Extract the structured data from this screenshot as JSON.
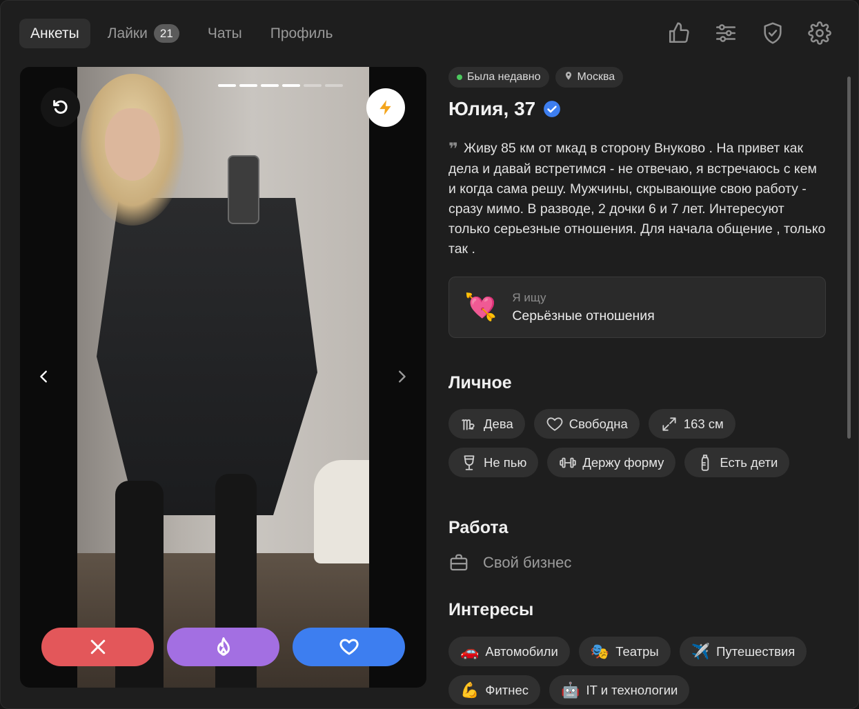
{
  "nav": {
    "tabs": [
      {
        "label": "Анкеты",
        "active": true
      },
      {
        "label": "Лайки",
        "badge": "21"
      },
      {
        "label": "Чаты"
      },
      {
        "label": "Профиль"
      }
    ],
    "icons": [
      "thumbs-up-icon",
      "sliders-icon",
      "shield-check-icon",
      "gear-icon"
    ]
  },
  "photo": {
    "count": 6,
    "current": 4,
    "undo_icon": "undo-icon",
    "boost_icon": "lightning-icon",
    "actions": [
      "close-icon",
      "flame-icon",
      "heart-icon"
    ]
  },
  "profile": {
    "status": "Была недавно",
    "city": "Москва",
    "name": "Юлия, 37",
    "verified": true,
    "bio": "Живу 85 км от мкад в сторону Внуково . На привет как дела и давай встретимся - не отвечаю, я встречаюсь с кем и когда сама решу. Мужчины, скрывающие свою работу - сразу мимо. В разводе, 2 дочки 6 и 7 лет. Интересуют только серьезные отношения. Для начала общение , только так .",
    "seeking": {
      "label": "Я ищу",
      "value": "Серьёзные отношения",
      "icon": "💘"
    },
    "personal": {
      "title": "Личное",
      "items": [
        {
          "icon": "virgo-icon",
          "label": "Дева"
        },
        {
          "icon": "heart-outline-icon",
          "label": "Свободна"
        },
        {
          "icon": "expand-icon",
          "label": "163 см"
        },
        {
          "icon": "glass-icon",
          "label": "Не пью"
        },
        {
          "icon": "dumbbell-icon",
          "label": "Держу форму"
        },
        {
          "icon": "baby-bottle-icon",
          "label": "Есть дети"
        }
      ]
    },
    "work": {
      "title": "Работа",
      "value": "Свой бизнес",
      "icon": "briefcase-icon"
    },
    "interests": {
      "title": "Интересы",
      "items": [
        {
          "emoji": "🚗",
          "label": "Автомобили"
        },
        {
          "emoji": "🎭",
          "label": "Театры"
        },
        {
          "emoji": "✈️",
          "label": "Путешествия"
        },
        {
          "emoji": "💪",
          "label": "Фитнес"
        },
        {
          "emoji": "🤖",
          "label": "IT и технологии"
        }
      ]
    }
  },
  "colors": {
    "background": "#1e1e1e",
    "dislike": "#e3575a",
    "superlike": "#a36fe2",
    "like": "#3d7ef0",
    "online": "#4cc95e",
    "verified": "#3d7ef0",
    "boost": "#f4a51c"
  }
}
